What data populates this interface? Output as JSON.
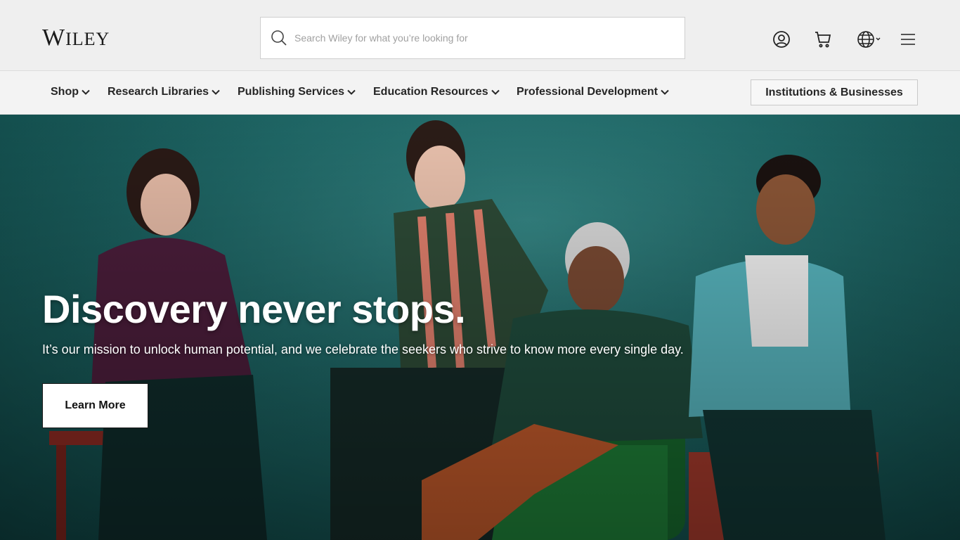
{
  "header": {
    "logo": {
      "big_w": "W",
      "rest": "ILEY"
    },
    "search": {
      "placeholder": "Search Wiley for what you’re looking for"
    },
    "icons": [
      "account-icon",
      "cart-icon",
      "globe-language-icon",
      "hamburger-menu-icon"
    ]
  },
  "nav": {
    "items": [
      {
        "label": "Shop"
      },
      {
        "label": "Research Libraries"
      },
      {
        "label": "Publishing Services"
      },
      {
        "label": "Education Resources"
      },
      {
        "label": "Professional Development"
      }
    ],
    "institutions_label": "Institutions & Businesses"
  },
  "hero": {
    "title": "Discovery never stops.",
    "subtitle": "It’s our mission to unlock human potential, and we celebrate the seekers who strive to know more every single day.",
    "cta_label": "Learn More"
  },
  "colors": {
    "header_bg": "#efefef",
    "nav_bg": "#f3f3f3",
    "hero_teal": "#1e6867",
    "text_dark": "#262626"
  }
}
